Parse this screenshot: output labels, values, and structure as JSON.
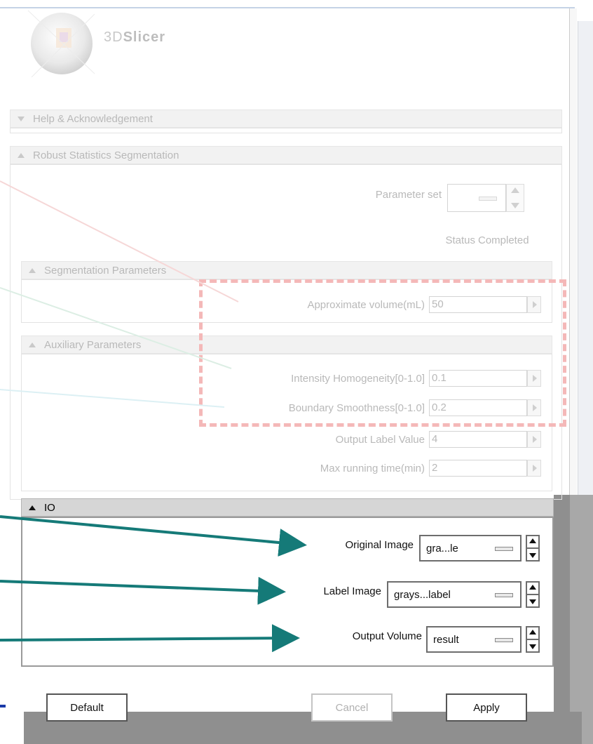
{
  "app": {
    "logo_text_prefix": "3D",
    "logo_text_bold": "Slicer"
  },
  "sections": {
    "help": {
      "title": "Help & Acknowledgement"
    },
    "robust": {
      "title": "Robust Statistics Segmentation",
      "parameter_set_label": "Parameter set",
      "status_label": "Status",
      "status_value": "Completed"
    },
    "segmentation": {
      "title": "Segmentation Parameters",
      "params": [
        {
          "label": "Approximate volume(mL)",
          "value": "50"
        }
      ]
    },
    "auxiliary": {
      "title": "Auxiliary Parameters",
      "params": [
        {
          "label": "Intensity Homogeneity[0-1.0]",
          "value": "0.1"
        },
        {
          "label": "Boundary Smoothness[0-1.0]",
          "value": "0.2"
        },
        {
          "label": "Output Label Value",
          "value": "4"
        },
        {
          "label": "Max running time(min)",
          "value": "2"
        }
      ]
    },
    "io": {
      "title": "IO",
      "fields": [
        {
          "label": "Original Image",
          "value": "gra...le"
        },
        {
          "label": "Label Image",
          "value": "grays...label"
        },
        {
          "label": "Output Volume",
          "value": "result"
        }
      ]
    }
  },
  "buttons": {
    "default": "Default",
    "cancel": "Cancel",
    "apply": "Apply"
  },
  "colors": {
    "annotation_arrow": "#157a78",
    "highlight_dash": "#f4b8b8",
    "bottom_left_mark": "#1a3aa8"
  }
}
